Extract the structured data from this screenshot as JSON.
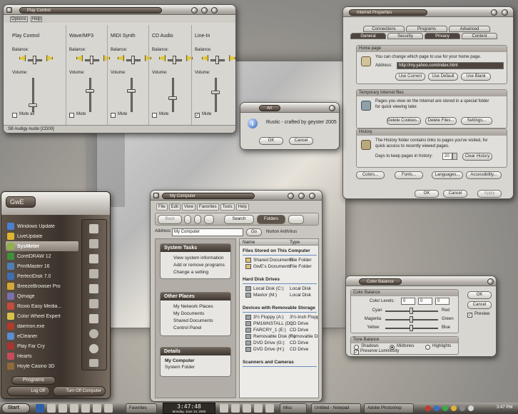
{
  "play_control": {
    "title": "Play Control",
    "menu": [
      "Options",
      "Help"
    ],
    "columns": [
      {
        "name": "Play Control",
        "mute": "Mute all",
        "checked": false
      },
      {
        "name": "Wave/MP3",
        "mute": "Mute",
        "checked": false
      },
      {
        "name": "MIDI Synth",
        "mute": "Mute",
        "checked": false
      },
      {
        "name": "CD Audio",
        "mute": "Mute",
        "checked": false
      },
      {
        "name": "Line-In",
        "mute": "Mute",
        "checked": true
      }
    ],
    "balance": "Balance:",
    "volume": "Volume:",
    "status": "SB Audigy Audio [CD00]"
  },
  "internet_properties": {
    "title": "Internet Properties",
    "tabs_back": [
      "Connections",
      "Programs",
      "Advanced"
    ],
    "tabs_front": [
      "General",
      "Security",
      "Privacy",
      "Content"
    ],
    "home": {
      "header": "Home page",
      "text": "You can change which page to use for your home page.",
      "address_label": "Address:",
      "address": "http://my.yahoo.com/index.html",
      "buttons": [
        "Use Current",
        "Use Default",
        "Use Blank"
      ]
    },
    "temp": {
      "header": "Temporary Internet files",
      "text1": "Pages you view on the Internet are stored in a special folder",
      "text2": "for quick viewing later.",
      "buttons": [
        "Delete Cookies...",
        "Delete Files...",
        "Settings..."
      ]
    },
    "history": {
      "header": "History",
      "text1": "The History folder contains links to pages you've visited, for",
      "text2": "quick access to recently viewed pages.",
      "days_label": "Days to keep pages in history:",
      "days": "20",
      "clear": "Clear History"
    },
    "bottom_buttons": [
      "Colors...",
      "Fonts...",
      "Languages...",
      "Accessibility..."
    ],
    "dialog_buttons": [
      "OK",
      "Cancel",
      "Apply"
    ]
  },
  "about": {
    "title": "Ari",
    "message": "Rustic - crafted by geyster 2005",
    "ok": "OK",
    "cancel": "Cancel"
  },
  "start_menu": {
    "user": "GwE",
    "items": [
      "Windows Update",
      "LiveUpdate",
      "SysMeter",
      "CorelDRAW 12",
      "PrintMaster 16",
      "PerfectDisk 7.0",
      "BreezeBrowser Pro",
      "Qimage",
      "Roxio Easy Media...",
      "Color Wheel Expert",
      "daemon.exe",
      "eCleaner",
      "Play Far Cry",
      "Hearts",
      "Hoyle Casino 3D"
    ],
    "programs": "Programs",
    "logoff": "Log Off",
    "turnoff": "Turn Off Computer"
  },
  "my_computer": {
    "title": "My Computer",
    "menu": [
      "File",
      "Edit",
      "View",
      "Favorites",
      "Tools",
      "Help"
    ],
    "toolbar": {
      "back": "Back",
      "search": "Search",
      "folders": "Folders"
    },
    "address_label": "Address",
    "address": "My Computer",
    "go": "Go",
    "norton": "Norton AntiVirus",
    "tasks": {
      "header": "System Tasks",
      "items": [
        "View system information",
        "Add or remove programs",
        "Change a setting"
      ]
    },
    "other": {
      "header": "Other Places",
      "items": [
        "My Network Places",
        "My Documents",
        "Shared Documents",
        "Control Panel"
      ]
    },
    "details": {
      "header": "Details",
      "name": "My Computer",
      "sub": "System Folder"
    },
    "columns": [
      "Name",
      "Type"
    ],
    "groups": [
      {
        "title": "Files Stored on This Computer",
        "rows": [
          [
            "Shared Documents",
            "File Folder"
          ],
          [
            "GwE's Documents",
            "File Folder"
          ]
        ]
      },
      {
        "title": "Hard Disk Drives",
        "rows": [
          [
            "Local Disk (C:)",
            "Local Disk"
          ],
          [
            "Maxtor (M:)",
            "Local Disk"
          ]
        ]
      },
      {
        "title": "Devices with Removable Storage",
        "rows": [
          [
            "3½ Floppy (A:)",
            "3½-Inch Floppy"
          ],
          [
            "PM16INSTALL (D:)",
            "CD Drive"
          ],
          [
            "FARCRY_1 (E:)",
            "CD Drive"
          ],
          [
            "Removable Disk (F:)",
            "Removable Disk"
          ],
          [
            "DVD Drive (G:)",
            "CD Drive"
          ],
          [
            "DVD Drive (H:)",
            "CD Drive"
          ]
        ]
      },
      {
        "title": "Scanners and Cameras",
        "rows": []
      }
    ]
  },
  "color_balance": {
    "title": "Color Balance",
    "group": "Color Balance",
    "levels_label": "Color Levels:",
    "levels": [
      "0",
      "0",
      "0"
    ],
    "sliders": [
      {
        "left": "Cyan",
        "right": "Red",
        "value": 0
      },
      {
        "left": "Magenta",
        "right": "Green",
        "value": 0
      },
      {
        "left": "Yellow",
        "right": "Blue",
        "value": 0
      }
    ],
    "tone": "Tone Balance",
    "tones": [
      "Shadows",
      "Midtones",
      "Highlights"
    ],
    "tone_selected": "Midtones",
    "luminosity": "Preserve Luminosity",
    "ok": "OK",
    "cancel": "Cancel",
    "preview": "Preview"
  },
  "taskbar": {
    "start": "Start",
    "favorites": "Favorites",
    "clock": "3:47:48",
    "date": "Monday, June 13, 2005",
    "misc": "Misc",
    "tasks": [
      "Untitled - Notepad",
      "Adobe Photoshop"
    ],
    "tray_time": "3:47 PM"
  }
}
